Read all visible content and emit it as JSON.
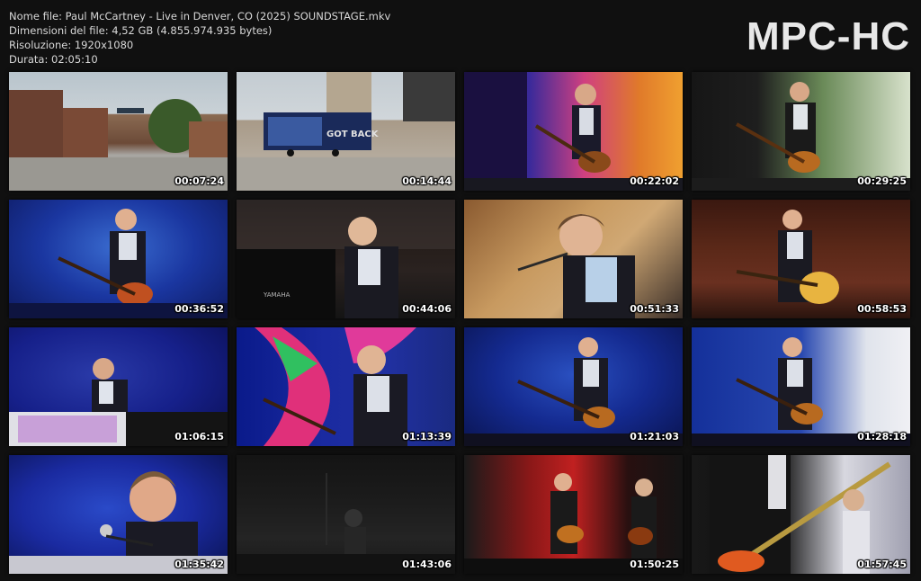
{
  "info": {
    "filename": "Nome file: Paul McCartney - Live in Denver, CO (2025) SOUNDSTAGE.mkv",
    "filesize": "Dimensioni del file: 4,52 GB (4.855.974.935 bytes)",
    "resolution": "Risoluzione: 1920x1080",
    "duration": "Durata: 02:05:10"
  },
  "logo": "MPC-HC",
  "thumbnails": [
    {
      "timestamp": "00:07:24"
    },
    {
      "timestamp": "00:14:44"
    },
    {
      "timestamp": "00:22:02"
    },
    {
      "timestamp": "00:29:25"
    },
    {
      "timestamp": "00:36:52"
    },
    {
      "timestamp": "00:44:06"
    },
    {
      "timestamp": "00:51:33"
    },
    {
      "timestamp": "00:58:53"
    },
    {
      "timestamp": "01:06:15"
    },
    {
      "timestamp": "01:13:39"
    },
    {
      "timestamp": "01:21:03"
    },
    {
      "timestamp": "01:28:18"
    },
    {
      "timestamp": "01:35:42"
    },
    {
      "timestamp": "01:43:06"
    },
    {
      "timestamp": "01:50:25"
    },
    {
      "timestamp": "01:57:45"
    }
  ],
  "scene_labels": {
    "trailer_text": "GOT BACK",
    "piano_brand": "YAMAHA"
  }
}
